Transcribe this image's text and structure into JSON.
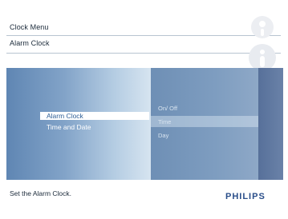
{
  "header": {
    "menu_title": "Clock Menu",
    "submenu_title": "Alarm Clock"
  },
  "menu": {
    "items": [
      {
        "label": "Alarm Clock",
        "selected": true
      },
      {
        "label": "Time and Date",
        "selected": false
      }
    ]
  },
  "submenu": {
    "items": [
      {
        "label": "On/ Off"
      },
      {
        "label": "Time"
      },
      {
        "label": "Day"
      }
    ]
  },
  "status": {
    "help_text": "Set the Alarm Clock."
  },
  "brand": {
    "name": "PHILIPS"
  },
  "colors": {
    "accent": "#2f5f97",
    "panel_blue": "#7e9dc0",
    "brand_blue": "#2a4e8a"
  },
  "icons": [
    "help-face-icon",
    "info-face-icon"
  ]
}
